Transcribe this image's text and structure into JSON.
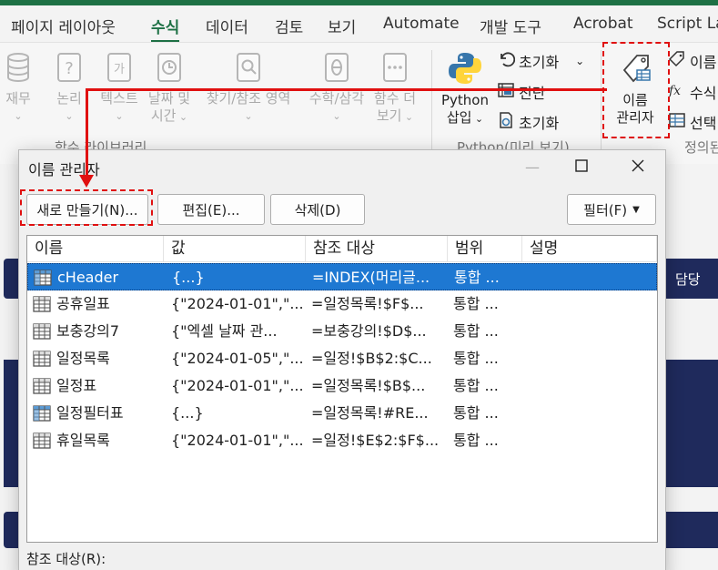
{
  "tabs": [
    {
      "label": "페이지 레이아웃",
      "active": false
    },
    {
      "label": "수식",
      "active": true
    },
    {
      "label": "데이터",
      "active": false
    },
    {
      "label": "검토",
      "active": false
    },
    {
      "label": "보기",
      "active": false
    },
    {
      "label": "Automate",
      "active": false
    },
    {
      "label": "개발 도구",
      "active": false
    },
    {
      "label": "Acrobat",
      "active": false
    },
    {
      "label": "Script Lab",
      "active": false
    }
  ],
  "ribbon": {
    "function_library": {
      "label": "함수 라이브러리",
      "buttons": [
        {
          "l1": "재무",
          "l2": "",
          "icon": "database-icon"
        },
        {
          "l1": "논리",
          "l2": "",
          "icon": "question-book-icon"
        },
        {
          "l1": "텍스트",
          "l2": "",
          "icon": "text-book-icon"
        },
        {
          "l1": "날짜 및",
          "l2": "시간",
          "icon": "clock-book-icon"
        },
        {
          "l1": "찾기/참조 영역",
          "l2": "",
          "icon": "magnifier-book-icon"
        },
        {
          "l1": "수학/삼각",
          "l2": "",
          "icon": "theta-book-icon"
        },
        {
          "l1": "함수 더",
          "l2": "보기",
          "icon": "more-book-icon"
        }
      ]
    },
    "python": {
      "label": "Python(미리 보기)",
      "insert_l1": "Python",
      "insert_l2": "삽입",
      "reset1": "초기화",
      "diagnose": "진단",
      "reset2": "초기화"
    },
    "defined_names": {
      "label": "정의된",
      "name_manager_l1": "이름",
      "name_manager_l2": "관리자",
      "define_name": "이름",
      "use_in_formula": "수식",
      "create_from_selection": "선택"
    }
  },
  "dialog": {
    "title": "이름 관리자",
    "buttons": {
      "new": "새로 만들기(N)...",
      "edit": "편집(E)...",
      "delete": "삭제(D)",
      "filter": "필터(F)"
    },
    "columns": [
      "이름",
      "값",
      "참조 대상",
      "범위",
      "설명"
    ],
    "rows": [
      {
        "name": "cHeader",
        "value": "{...}",
        "ref": "=INDEX(머리글...",
        "scope": "통합 ...",
        "desc": "",
        "icon": "table-name-icon",
        "selected": true
      },
      {
        "name": "공휴일표",
        "value": "{\"2024-01-01\",\"...",
        "ref": "=일정목록!$F$...",
        "scope": "통합 ...",
        "desc": "",
        "icon": "named-range-icon",
        "selected": false
      },
      {
        "name": "보충강의7",
        "value": "{\"엑셀 날짜 관...",
        "ref": "=보충강의!$D$...",
        "scope": "통합 ...",
        "desc": "",
        "icon": "named-range-icon",
        "selected": false
      },
      {
        "name": "일정목록",
        "value": "{\"2024-01-05\",\"...",
        "ref": "=일정!$B$2:$C...",
        "scope": "통합 ...",
        "desc": "",
        "icon": "named-range-icon",
        "selected": false
      },
      {
        "name": "일정표",
        "value": "{\"2024-01-01\",\"...",
        "ref": "=일정목록!$B$...",
        "scope": "통합 ...",
        "desc": "",
        "icon": "named-range-icon",
        "selected": false
      },
      {
        "name": "일정필터표",
        "value": "{...}",
        "ref": "=일정목록!#RE...",
        "scope": "통합 ...",
        "desc": "",
        "icon": "table-name-icon",
        "selected": false
      },
      {
        "name": "휴일목록",
        "value": "{\"2024-01-01\",\"...",
        "ref": "=일정!$E$2:$F$...",
        "scope": "통합 ...",
        "desc": "",
        "icon": "named-range-icon",
        "selected": false
      }
    ],
    "ref_label": "참조 대상(R):"
  },
  "background": {
    "right_text": "담당"
  },
  "colors": {
    "accent": "#1e7145",
    "selection": "#1e78d2",
    "highlight": "#e01010"
  }
}
